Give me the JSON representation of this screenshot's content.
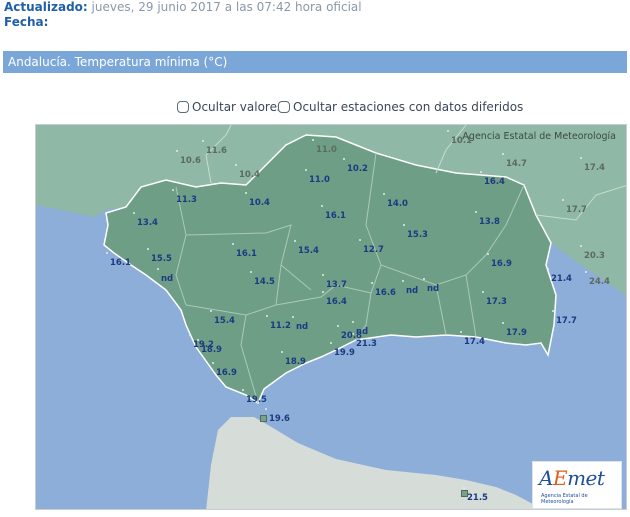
{
  "header": {
    "updated_label": "Actualizado:",
    "updated_value": "jueves, 29 junio 2017 a las 07:42 hora oficial",
    "date_label": "Fecha:"
  },
  "title": "Andalucía. Temperatura mínima (°C)",
  "toggles": {
    "hide_values": "Ocultar valores",
    "hide_deferred": "Ocultar estaciones con datos diferidos"
  },
  "map": {
    "watermark": "Agencia Estatal de Meteorología",
    "logo": {
      "pre": "A",
      "mid": "E",
      "post": "met",
      "subtitle": "Agencia Estatal de Meteorología"
    },
    "colors": {
      "sea": "#8daed8",
      "land_outside": "#8fb8a6",
      "land_andalucia": "#6f9e87",
      "border_province": "#a9c9ba",
      "border_outside": "#c8dcd2",
      "label": "#1c3a82"
    }
  },
  "stations": [
    {
      "value": "10.6",
      "outside": true
    },
    {
      "value": "11.6",
      "outside": true
    },
    {
      "value": "10.4",
      "outside": true
    },
    {
      "value": "11.0",
      "outside": true
    },
    {
      "value": "10.1",
      "outside": true
    },
    {
      "value": "14.7",
      "outside": true
    },
    {
      "value": "17.4",
      "outside": true
    },
    {
      "value": "17.7",
      "outside": true
    },
    {
      "value": "20.3",
      "outside": true
    },
    {
      "value": "24.4",
      "outside": true
    },
    {
      "value": "11.0"
    },
    {
      "value": "11.3"
    },
    {
      "value": "10.4"
    },
    {
      "value": "10.2"
    },
    {
      "value": "14.0"
    },
    {
      "value": "16.4"
    },
    {
      "value": "13.4"
    },
    {
      "value": "16.1"
    },
    {
      "value": "15.5"
    },
    {
      "value": "13.8"
    },
    {
      "value": "16.1"
    },
    {
      "value": "15.4"
    },
    {
      "value": "16.1"
    },
    {
      "value": "15.3"
    },
    {
      "value": "12.7"
    },
    {
      "value": "16.9"
    },
    {
      "value": "nd"
    },
    {
      "value": "14.5"
    },
    {
      "value": "13.7"
    },
    {
      "value": "21.4"
    },
    {
      "value": "16.4"
    },
    {
      "value": "16.6"
    },
    {
      "value": "nd"
    },
    {
      "value": "nd"
    },
    {
      "value": "17.3"
    },
    {
      "value": "15.4"
    },
    {
      "value": "11.2"
    },
    {
      "value": "nd"
    },
    {
      "value": "17.7"
    },
    {
      "value": "20.8"
    },
    {
      "value": "nd"
    },
    {
      "value": "19.2"
    },
    {
      "value": "21.3"
    },
    {
      "value": "17.9"
    },
    {
      "value": "17.4"
    },
    {
      "value": "18.9"
    },
    {
      "value": "19.9"
    },
    {
      "value": "18.9"
    },
    {
      "value": "16.9"
    },
    {
      "value": "19.5"
    },
    {
      "value": "19.6"
    },
    {
      "value": "21.5"
    }
  ]
}
